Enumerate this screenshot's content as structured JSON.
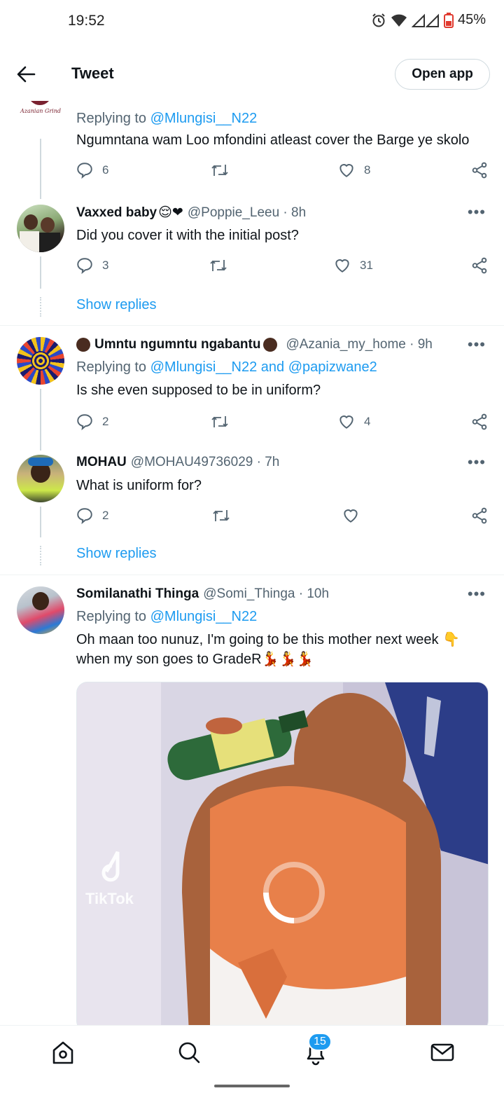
{
  "status_bar": {
    "time": "19:52",
    "battery": "45%"
  },
  "header": {
    "title": "Tweet",
    "open_app_label": "Open app"
  },
  "tweets": [
    {
      "reply_prefix": "Replying to ",
      "reply_to": "@Mlungisi__N22",
      "text": "Ngumntana wam Loo mfondini atleast cover the Barge ye skolo",
      "replies": "6",
      "retweets": "",
      "likes": "8",
      "avatar_text": "A",
      "avatar_caption": "Azanian Grind"
    },
    {
      "name": "Vaxxed baby",
      "name_emoji": "😌❤",
      "handle": "@Poppie_Leeu · 8h",
      "text": "Did you cover it with the initial post?",
      "replies": "3",
      "retweets": "",
      "likes": "31",
      "show_replies": "Show replies"
    },
    {
      "name": "Umntu ngumntu ngabantu",
      "handle": "@Azania_my_home · 9h",
      "reply_prefix": "Replying to ",
      "reply_to": "@Mlungisi__N22 and @papizwane2",
      "text": "Is she even supposed to be in uniform?",
      "replies": "2",
      "retweets": "",
      "likes": "4"
    },
    {
      "name": "MOHAU",
      "handle": "@MOHAU49736029 · 7h",
      "text": "What is uniform for?",
      "replies": "2",
      "retweets": "",
      "likes": "",
      "show_replies": "Show replies"
    },
    {
      "name": "Somilanathi Thinga",
      "handle": "@Somi_Thinga · 10h",
      "reply_prefix": "Replying to ",
      "reply_to": "@Mlungisi__N22",
      "text": "Oh maan too nunuz, I'm going to be this mother next week 👇 when my son goes to GradeR💃💃💃",
      "media_watermark": "TikTok"
    }
  ],
  "bottom_nav": {
    "notifications_badge": "15"
  },
  "colors": {
    "accent": "#1d9bf0",
    "secondary_text": "#536471",
    "divider": "#eff3f4"
  }
}
